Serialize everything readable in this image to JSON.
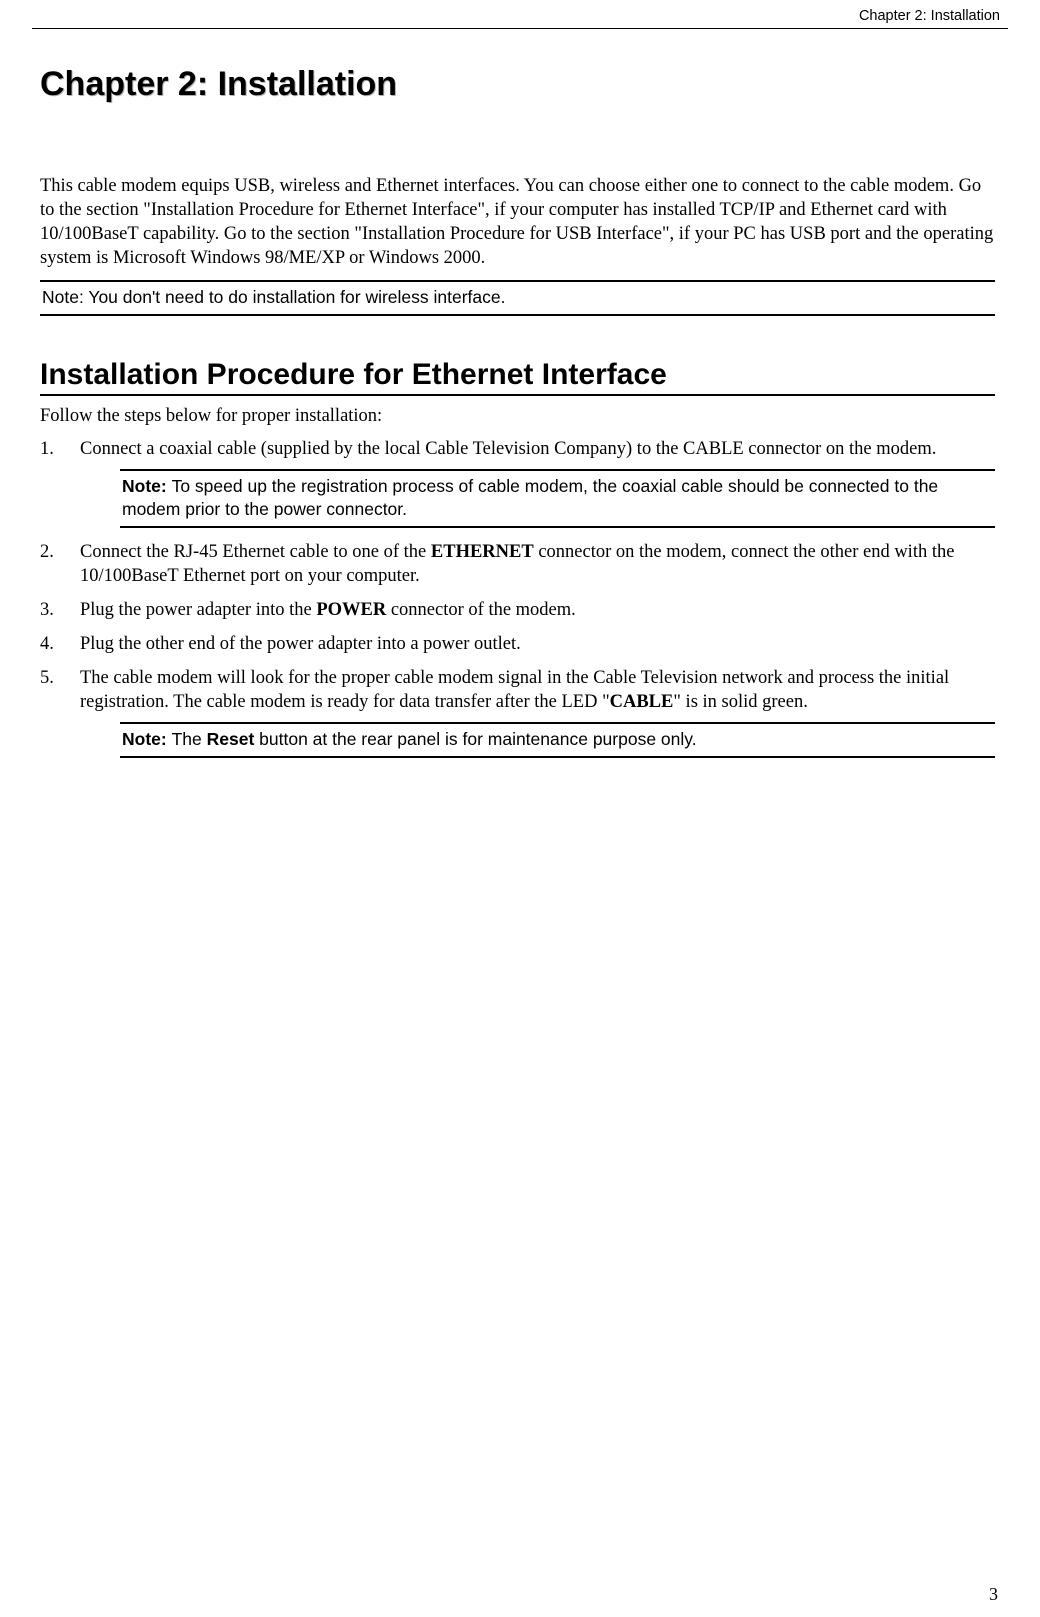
{
  "header": {
    "text": "Chapter 2: Installation"
  },
  "chapter_title": "Chapter 2: Installation",
  "intro": "This cable modem equips USB, wireless and Ethernet interfaces. You can choose either one to connect to the cable modem. Go to the section \"Installation Procedure for Ethernet Interface\", if your computer has installed TCP/IP and Ethernet card with 10/100BaseT capability. Go to the section \"Installation Procedure for USB Interface\", if your PC has USB port and the operating system is Microsoft Windows 98/ME/XP or Windows 2000.",
  "note1": "Note: You don't need to do installation for wireless interface.",
  "section_title": "Installation Procedure for Ethernet Interface",
  "follow": "Follow the steps below for proper installation:",
  "steps": {
    "s1": "Connect a coaxial cable (supplied by the local Cable Television Company) to the CABLE connector on the modem.",
    "s2a": "Connect the RJ-45 Ethernet cable to one of the ",
    "s2b": "ETHERNET",
    "s2c": " connector on the modem, connect the other end with the 10/100BaseT Ethernet port on your computer.",
    "s3a": "Plug the power adapter into the ",
    "s3b": "POWER",
    "s3c": " connector of the modem.",
    "s4": "Plug the other end of the power adapter into a power outlet.",
    "s5a": "The cable modem will look for the proper cable modem signal in the Cable Television network and process the initial registration. The cable modem is ready for data transfer after the LED \"",
    "s5b": "CABLE",
    "s5c": "\" is in solid green."
  },
  "note2": {
    "label": "Note: ",
    "text": "To speed up the registration process of cable modem, the coaxial cable should be connected to the modem prior to the power connector."
  },
  "note3": {
    "label": "Note: ",
    "prefix": "The ",
    "bold": "Reset",
    "suffix": " button at the rear panel is for maintenance purpose only."
  },
  "page_number": "3"
}
